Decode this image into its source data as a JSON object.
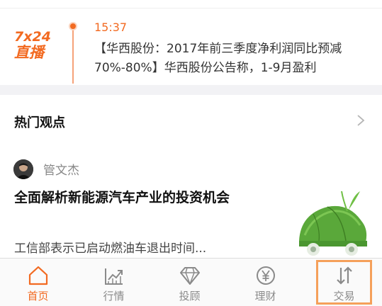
{
  "live": {
    "logo_line1": "7x24",
    "logo_line2": "直播",
    "time": "15:37",
    "text": "【华西股份：2017年前三季度净利润同比预减70%-80%】华西股份公告称，1-9月盈利"
  },
  "hot": {
    "title": "热门观点",
    "article": {
      "author": "管文杰",
      "headline": "全面解析新能源汽车产业的投资机会",
      "summary": "工信部表示已启动燃油车退出时间..."
    }
  },
  "tabs": [
    {
      "label": "首页",
      "icon": "home-icon",
      "active": true
    },
    {
      "label": "行情",
      "icon": "trend-chart-icon",
      "active": false
    },
    {
      "label": "投顾",
      "icon": "diamond-icon",
      "active": false
    },
    {
      "label": "理财",
      "icon": "yen-coin-icon",
      "active": false
    },
    {
      "label": "交易",
      "icon": "swap-arrows-icon",
      "active": false
    }
  ],
  "colors": {
    "accent": "#f26a21",
    "inactive": "#8a8a8a",
    "highlight": "#f5a05a"
  }
}
